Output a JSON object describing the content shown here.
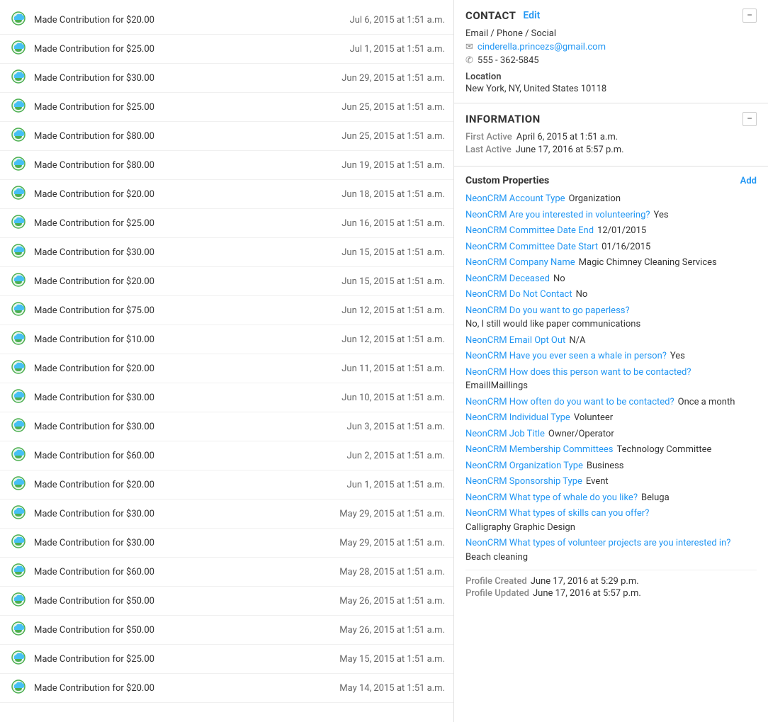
{
  "activities": [
    {
      "label": "Made Contribution for $20.00",
      "date": "Jul 6, 2015 at 1:51 a.m."
    },
    {
      "label": "Made Contribution for $25.00",
      "date": "Jul 1, 2015 at 1:51 a.m."
    },
    {
      "label": "Made Contribution for $30.00",
      "date": "Jun 29, 2015 at 1:51 a.m."
    },
    {
      "label": "Made Contribution for $25.00",
      "date": "Jun 25, 2015 at 1:51 a.m."
    },
    {
      "label": "Made Contribution for $80.00",
      "date": "Jun 25, 2015 at 1:51 a.m."
    },
    {
      "label": "Made Contribution for $80.00",
      "date": "Jun 19, 2015 at 1:51 a.m."
    },
    {
      "label": "Made Contribution for $20.00",
      "date": "Jun 18, 2015 at 1:51 a.m."
    },
    {
      "label": "Made Contribution for $25.00",
      "date": "Jun 16, 2015 at 1:51 a.m."
    },
    {
      "label": "Made Contribution for $30.00",
      "date": "Jun 15, 2015 at 1:51 a.m."
    },
    {
      "label": "Made Contribution for $20.00",
      "date": "Jun 15, 2015 at 1:51 a.m."
    },
    {
      "label": "Made Contribution for $75.00",
      "date": "Jun 12, 2015 at 1:51 a.m."
    },
    {
      "label": "Made Contribution for $10.00",
      "date": "Jun 12, 2015 at 1:51 a.m."
    },
    {
      "label": "Made Contribution for $20.00",
      "date": "Jun 11, 2015 at 1:51 a.m."
    },
    {
      "label": "Made Contribution for $30.00",
      "date": "Jun 10, 2015 at 1:51 a.m."
    },
    {
      "label": "Made Contribution for $30.00",
      "date": "Jun 3, 2015 at 1:51 a.m."
    },
    {
      "label": "Made Contribution for $60.00",
      "date": "Jun 2, 2015 at 1:51 a.m."
    },
    {
      "label": "Made Contribution for $20.00",
      "date": "Jun 1, 2015 at 1:51 a.m."
    },
    {
      "label": "Made Contribution for $30.00",
      "date": "May 29, 2015 at 1:51 a.m."
    },
    {
      "label": "Made Contribution for $30.00",
      "date": "May 29, 2015 at 1:51 a.m."
    },
    {
      "label": "Made Contribution for $60.00",
      "date": "May 28, 2015 at 1:51 a.m."
    },
    {
      "label": "Made Contribution for $50.00",
      "date": "May 26, 2015 at 1:51 a.m."
    },
    {
      "label": "Made Contribution for $50.00",
      "date": "May 26, 2015 at 1:51 a.m."
    },
    {
      "label": "Made Contribution for $25.00",
      "date": "May 15, 2015 at 1:51 a.m."
    },
    {
      "label": "Made Contribution for $20.00",
      "date": "May 14, 2015 at 1:51 a.m."
    }
  ],
  "contact": {
    "section_title": "CONTACT",
    "edit_label": "Edit",
    "email_phone_social_label": "Email / Phone / Social",
    "email": "cinderella.princezs@gmail.com",
    "phone": "555 - 362-5845",
    "location_label": "Location",
    "location_value": "New York, NY, United States 10118"
  },
  "information": {
    "section_title": "INFORMATION",
    "first_active_label": "First Active",
    "first_active_value": "April 6, 2015 at 1:51 a.m.",
    "last_active_label": "Last Active",
    "last_active_value": "June 17, 2016 at 5:57 p.m."
  },
  "custom_properties": {
    "title": "Custom Properties",
    "add_label": "Add",
    "properties": [
      {
        "key": "NeonCRM Account Type",
        "value": "Organization"
      },
      {
        "key": "NeonCRM Are you interested in volunteering?",
        "value": "Yes"
      },
      {
        "key": "NeonCRM Committee Date End",
        "value": "12/01/2015"
      },
      {
        "key": "NeonCRM Committee Date Start",
        "value": "01/16/2015"
      },
      {
        "key": "NeonCRM Company Name",
        "value": "Magic Chimney Cleaning Services"
      },
      {
        "key": "NeonCRM Deceased",
        "value": "No"
      },
      {
        "key": "NeonCRM Do Not Contact",
        "value": "No"
      },
      {
        "key": "NeonCRM Do you want to go paperless?",
        "value": "No, I still would like paper communications"
      },
      {
        "key": "NeonCRM Email Opt Out",
        "value": "N/A"
      },
      {
        "key": "NeonCRM Have you ever seen a whale in person?",
        "value": "Yes"
      },
      {
        "key": "NeonCRM How does this person want to be contacted?",
        "value": "EmailIMaillings"
      },
      {
        "key": "NeonCRM How often do you want to be contacted?",
        "value": "Once a month"
      },
      {
        "key": "NeonCRM Individual Type",
        "value": "Volunteer"
      },
      {
        "key": "NeonCRM Job Title",
        "value": "Owner/Operator"
      },
      {
        "key": "NeonCRM Membership Committees",
        "value": "Technology Committee"
      },
      {
        "key": "NeonCRM Organization Type",
        "value": "Business"
      },
      {
        "key": "NeonCRM Sponsorship Type",
        "value": "Event"
      },
      {
        "key": "NeonCRM What type of whale do you like?",
        "value": "Beluga"
      },
      {
        "key": "NeonCRM What types of skills can you offer?",
        "value": "Calligraphy Graphic Design"
      },
      {
        "key": "NeonCRM What types of volunteer projects are you interested in?",
        "value": "Beach cleaning"
      }
    ],
    "profile_created_label": "Profile Created",
    "profile_created_value": "June 17, 2016 at 5:29 p.m.",
    "profile_updated_label": "Profile Updated",
    "profile_updated_value": "June 17, 2016 at 5:57 p.m."
  },
  "icons": {
    "contribution_icon": "contribution-icon",
    "collapse_icon": "−",
    "email_icon": "✉",
    "phone_icon": "✆"
  }
}
